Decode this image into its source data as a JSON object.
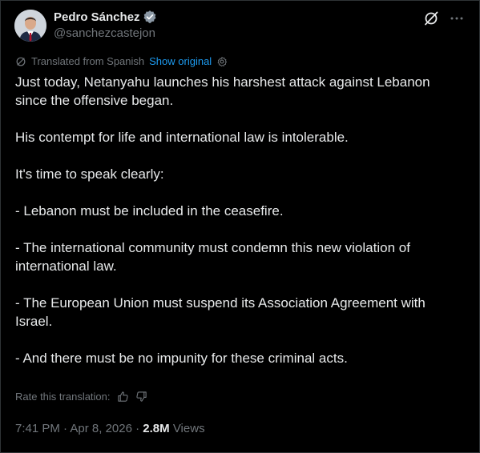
{
  "author": {
    "name": "Pedro Sánchez",
    "handle": "@sanchezcastejon"
  },
  "translation": {
    "label": "Translated from Spanish",
    "show_original": "Show original",
    "rate_label": "Rate this translation:"
  },
  "post": {
    "paragraphs": [
      "Just today, Netanyahu launches his harshest attack against Lebanon since the offensive began.",
      "His contempt for life and international law is intolerable.",
      "It's time to speak clearly:",
      "- Lebanon must be included in the ceasefire.",
      "- The international community must condemn this new violation of international law.",
      "- The European Union must suspend its Association Agreement with Israel.",
      "- And there must be no impunity for these criminal acts."
    ]
  },
  "meta": {
    "time": "7:41 PM",
    "separator": "·",
    "date": "Apr 8, 2026",
    "views_count": "2.8M",
    "views_label": "Views"
  },
  "icons": {
    "verified": "verified-badge-icon",
    "grok": "grok-icon",
    "more": "more-icon",
    "translate": "translate-icon",
    "settings": "gear-icon",
    "thumbs_up": "thumbs-up-icon",
    "thumbs_down": "thumbs-down-icon"
  },
  "colors": {
    "background": "#000000",
    "text": "#e7e9ea",
    "muted": "#71767b",
    "link": "#1d9bf0",
    "border": "#2f3336"
  }
}
